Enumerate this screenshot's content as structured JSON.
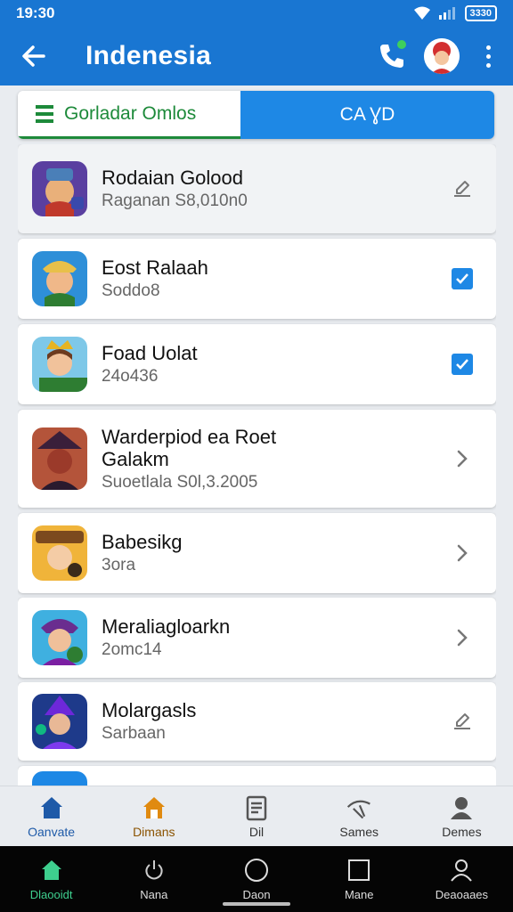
{
  "status_bar": {
    "time": "19:30",
    "battery": "3330"
  },
  "app_bar": {
    "title": "Indenesia",
    "back_icon": "arrow-left-icon",
    "call_icon": "phone-icon",
    "more_icon": "more-vert-icon"
  },
  "tabs": {
    "left_label": "Gorladar Omlos",
    "right_label": "CA ƔD"
  },
  "list": {
    "items": [
      {
        "title": "Rodaian Golood",
        "subtitle": "Raganan  S8,010n0",
        "action": "edit-icon"
      },
      {
        "title": "Eost Ralaah",
        "subtitle": "Soddo8",
        "action": "checkbox-checked"
      },
      {
        "title": "Foad Uolat",
        "subtitle": "24o436",
        "action": "checkbox-checked"
      },
      {
        "title": "Warderpiod ea Roet",
        "title2": "Galakm",
        "subtitle": "Suoetlala S0l,3.2005",
        "action": "chevron-right-icon"
      },
      {
        "title": "Babesikg",
        "subtitle": "3ora",
        "action": "chevron-right-icon"
      },
      {
        "title": "Meraliagloarkn",
        "subtitle": "2omc14",
        "action": "chevron-right-icon"
      },
      {
        "title": "Molargasls",
        "subtitle": "Sarbaan",
        "action": "edit-icon"
      }
    ]
  },
  "bottom_nav": {
    "items": [
      {
        "label": "Oanvate",
        "icon": "home-icon",
        "color": "#1e5aa8"
      },
      {
        "label": "Dimans",
        "icon": "home-icon",
        "color": "#e08a10"
      },
      {
        "label": "Dil",
        "icon": "document-icon",
        "color": "#555555"
      },
      {
        "label": "Sames",
        "icon": "satellite-icon",
        "color": "#555555"
      },
      {
        "label": "Demes",
        "icon": "person-icon",
        "color": "#555555"
      }
    ]
  },
  "system_nav": {
    "items": [
      {
        "label": "Dlaooidt",
        "icon": "home-icon"
      },
      {
        "label": "Nana",
        "icon": "power-icon"
      },
      {
        "label": "Daon",
        "icon": "circle-icon"
      },
      {
        "label": "Mane",
        "icon": "square-icon"
      },
      {
        "label": "Deaoaaes",
        "icon": "person-icon"
      }
    ]
  },
  "colors": {
    "primary": "#1976d2",
    "accent_green": "#1d8a3a",
    "tab_blue": "#1e88e5",
    "check_blue": "#1e88e5",
    "nav_active": "#e08a10"
  }
}
